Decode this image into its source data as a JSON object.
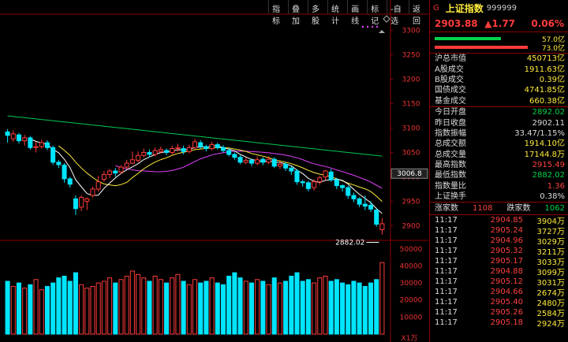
{
  "toolbar": [
    "指标",
    "叠加",
    "多股",
    "统计",
    "画线",
    "标记",
    "-自选",
    "返回"
  ],
  "header": {
    "g": "G",
    "name": "上证指数",
    "code": "999999"
  },
  "quote": {
    "price": "2903.88",
    "change": "▲1.77",
    "pct": "0.06%"
  },
  "ratio_bars": {
    "green_label": "57.0亿",
    "red_label": "73.0亿",
    "green_color": "#00d24a",
    "red_color": "#ff3b3b",
    "green_fraction": 0.44,
    "red_fraction": 0.56
  },
  "market": [
    {
      "label": "沪总市值",
      "value": "450713亿"
    },
    {
      "label": "A股成交",
      "value": "1911.63亿"
    },
    {
      "label": "B股成交",
      "value": "0.39亿"
    },
    {
      "label": "国债成交",
      "value": "4741.85亿"
    },
    {
      "label": "基金成交",
      "value": "660.38亿"
    }
  ],
  "stats": [
    {
      "label": "今日开盘",
      "value": "2892.02",
      "color": "green"
    },
    {
      "label": "昨日收盘",
      "value": "2902.11",
      "color": "white"
    },
    {
      "label": "指数振幅",
      "value": "33.47/1.15%",
      "color": "white"
    },
    {
      "label": "总成交额",
      "value": "1914.10亿",
      "color": "yellow"
    },
    {
      "label": "总成交量",
      "value": "17144.8万",
      "color": "yellow"
    },
    {
      "label": "最高指数",
      "value": "2915.49",
      "color": "red"
    },
    {
      "label": "最低指数",
      "value": "2882.02",
      "color": "green"
    },
    {
      "label": "指数量比",
      "value": "1.36",
      "color": "red"
    },
    {
      "label": "上证换手",
      "value": "0.38%",
      "color": "white"
    }
  ],
  "breadth": {
    "up_label": "涨家数",
    "up": "1108",
    "down_label": "跌家数",
    "down": "1062"
  },
  "ticks": [
    {
      "t": "11:17",
      "p": "2904.85",
      "v": "3904万"
    },
    {
      "t": "11:17",
      "p": "2905.24",
      "v": "3727万"
    },
    {
      "t": "11:17",
      "p": "2904.96",
      "v": "3029万"
    },
    {
      "t": "11:17",
      "p": "2905.32",
      "v": "3211万"
    },
    {
      "t": "11:17",
      "p": "2905.17",
      "v": "3033万"
    },
    {
      "t": "11:17",
      "p": "2904.88",
      "v": "3099万"
    },
    {
      "t": "11:17",
      "p": "2905.12",
      "v": "3031万"
    },
    {
      "t": "11:17",
      "p": "2904.66",
      "v": "2674万"
    },
    {
      "t": "11:17",
      "p": "2905.40",
      "v": "2480万"
    },
    {
      "t": "11:17",
      "p": "2905.26",
      "v": "2584万"
    },
    {
      "t": "11:17",
      "p": "2905.18",
      "v": "2924万"
    }
  ],
  "chart_data": {
    "type": "candlestick",
    "price_axis": [
      3300,
      3250,
      3200,
      3150,
      3100,
      3050,
      3000,
      2950,
      2900
    ],
    "price_range": [
      2870,
      3330
    ],
    "current_label": "3006.8",
    "low_label": "2882.02",
    "volume_axis": [
      "50000",
      "40000",
      "30000",
      "20000",
      "10000"
    ],
    "volume_unit": "X1万",
    "volume_range": [
      0,
      55000
    ],
    "colors": {
      "up": "#ff3b3b",
      "down": "#00e5ff",
      "ma5": "#ffffff",
      "ma10": "#ffeb3b",
      "ma20": "#e040fb",
      "ma60": "#00c853"
    },
    "candles": [
      [
        3092,
        3085,
        3098,
        3070
      ],
      [
        3078,
        3088,
        3095,
        3072
      ],
      [
        3086,
        3074,
        3090,
        3068
      ],
      [
        3074,
        3080,
        3086,
        3064
      ],
      [
        3080,
        3060,
        3084,
        3056
      ],
      [
        3060,
        3062,
        3072,
        3050
      ],
      [
        3062,
        3070,
        3076,
        3058
      ],
      [
        3070,
        3060,
        3075,
        3055
      ],
      [
        3060,
        3030,
        3064,
        3025
      ],
      [
        3030,
        3025,
        3035,
        3018
      ],
      [
        3024,
        2996,
        3028,
        2988
      ],
      [
        2996,
        2985,
        3000,
        2978
      ],
      [
        2955,
        2935,
        2962,
        2922
      ],
      [
        2938,
        2958,
        2962,
        2930
      ],
      [
        2950,
        2955,
        2958,
        2932
      ],
      [
        2962,
        2975,
        2980,
        2958
      ],
      [
        2975,
        2990,
        3002,
        2970
      ],
      [
        2995,
        3005,
        3012,
        2990
      ],
      [
        3005,
        3012,
        3016,
        2998
      ],
      [
        3012,
        3008,
        3018,
        3000
      ],
      [
        3010,
        3020,
        3024,
        3006
      ],
      [
        3020,
        3028,
        3035,
        3016
      ],
      [
        3028,
        3035,
        3052,
        3026
      ],
      [
        3034,
        3044,
        3052,
        3030
      ],
      [
        3044,
        3050,
        3058,
        3040
      ],
      [
        3050,
        3046,
        3056,
        3040
      ],
      [
        3046,
        3054,
        3060,
        3042
      ],
      [
        3052,
        3056,
        3062,
        3048
      ],
      [
        3054,
        3050,
        3058,
        3044
      ],
      [
        3050,
        3058,
        3064,
        3046
      ],
      [
        3058,
        3060,
        3068,
        3052
      ],
      [
        3058,
        3052,
        3064,
        3046
      ],
      [
        3052,
        3060,
        3066,
        3048
      ],
      [
        3060,
        3072,
        3078,
        3056
      ],
      [
        3070,
        3062,
        3075,
        3058
      ],
      [
        3062,
        3058,
        3066,
        3052
      ],
      [
        3058,
        3066,
        3072,
        3054
      ],
      [
        3066,
        3060,
        3070,
        3056
      ],
      [
        3060,
        3054,
        3065,
        3050
      ],
      [
        3054,
        3046,
        3058,
        3042
      ],
      [
        3046,
        3040,
        3050,
        3035
      ],
      [
        3040,
        3030,
        3044,
        3026
      ],
      [
        3030,
        3034,
        3040,
        3026
      ],
      [
        3034,
        3028,
        3038,
        3022
      ],
      [
        3028,
        3035,
        3042,
        3024
      ],
      [
        3036,
        3030,
        3040,
        3024
      ],
      [
        3030,
        3036,
        3042,
        3026
      ],
      [
        3036,
        3022,
        3040,
        3018
      ],
      [
        3022,
        3026,
        3032,
        3016
      ],
      [
        3026,
        3018,
        3030,
        3012
      ],
      [
        3018,
        3012,
        3022,
        3004
      ],
      [
        3012,
        2990,
        3016,
        2984
      ],
      [
        2990,
        2988,
        2994,
        2980
      ],
      [
        2988,
        2976,
        2992,
        2970
      ],
      [
        2978,
        2990,
        2995,
        2972
      ],
      [
        2990,
        2998,
        3002,
        2984
      ],
      [
        3000,
        3012,
        3014,
        2994
      ],
      [
        3010,
        2994,
        3016,
        2990
      ],
      [
        2994,
        2982,
        2998,
        2975
      ],
      [
        2982,
        2978,
        2985,
        2970
      ],
      [
        2978,
        2962,
        2982,
        2955
      ],
      [
        2962,
        2955,
        2968,
        2948
      ],
      [
        2955,
        2944,
        2958,
        2938
      ],
      [
        2944,
        2940,
        2962,
        2932
      ],
      [
        2942,
        2934,
        2950,
        2928
      ],
      [
        2932,
        2903,
        2935,
        2898
      ],
      [
        2892,
        2904,
        2915,
        2882
      ]
    ],
    "volumes": [
      31000,
      28000,
      30000,
      27000,
      29000,
      32000,
      26000,
      28000,
      30000,
      33000,
      34000,
      31000,
      36000,
      29000,
      27000,
      28000,
      30000,
      31000,
      33000,
      30000,
      32000,
      34000,
      37000,
      35000,
      33000,
      31000,
      34000,
      32000,
      30000,
      33000,
      35000,
      31000,
      29000,
      32000,
      30000,
      31000,
      33000,
      30000,
      29000,
      34000,
      36000,
      33000,
      31000,
      30000,
      32000,
      31000,
      29000,
      33000,
      30000,
      31000,
      34000,
      36000,
      31000,
      32000,
      30000,
      33000,
      34000,
      31000,
      32000,
      30000,
      29000,
      31000,
      30000,
      28000,
      30000,
      32000,
      42000
    ]
  }
}
